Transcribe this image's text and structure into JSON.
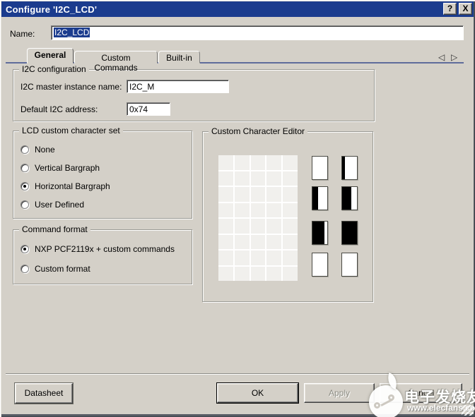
{
  "window": {
    "title": "Configure 'I2C_LCD'",
    "help": "?",
    "close": "X"
  },
  "name_row": {
    "label": "Name:",
    "value": "I2C_LCD"
  },
  "tab_bar": {
    "tabs": [
      {
        "label": "General",
        "active": true
      },
      {
        "label": "Custom Commands",
        "active": false
      },
      {
        "label": "Built-in",
        "active": false
      }
    ],
    "scroll_left": "◁",
    "scroll_right": "▷"
  },
  "i2c_group": {
    "title": "I2C configuration",
    "master_label": "I2C master instance name:",
    "master_value": "I2C_M",
    "address_label": "Default I2C address:",
    "address_value": "0x74"
  },
  "charset_group": {
    "title": "LCD custom character set",
    "options": [
      {
        "label": "None",
        "selected": false
      },
      {
        "label": "Vertical Bargraph",
        "selected": false
      },
      {
        "label": "Horizontal Bargraph",
        "selected": true
      },
      {
        "label": "User Defined",
        "selected": false
      }
    ]
  },
  "format_group": {
    "title": "Command format",
    "options": [
      {
        "label": "NXP PCF2119x + custom commands",
        "selected": true
      },
      {
        "label": "Custom format",
        "selected": false
      }
    ]
  },
  "editor_group": {
    "title": "Custom Character Editor",
    "grid": {
      "rows": 8,
      "cols": 5
    },
    "preview_total_cols": 5,
    "previews": [
      {
        "filled_cols": 0
      },
      {
        "filled_cols": 1
      },
      {
        "filled_cols": 2
      },
      {
        "filled_cols": 3
      },
      {
        "filled_cols": 4
      },
      {
        "filled_cols": 5
      },
      {
        "filled_cols": 0
      },
      {
        "filled_cols": 0
      }
    ]
  },
  "footer": {
    "datasheet": "Datasheet",
    "ok": "OK",
    "apply": "Apply",
    "apply_enabled": false,
    "cancel": "Cancel"
  },
  "watermark": {
    "brand": "电子发烧友",
    "site": "www.elecfans.com"
  },
  "colors": {
    "titlebar": "#1b3c8e",
    "dialog_bg": "#d4d0c8",
    "selection": "#1b3c8e",
    "tab_line": "#5f6c9b"
  }
}
